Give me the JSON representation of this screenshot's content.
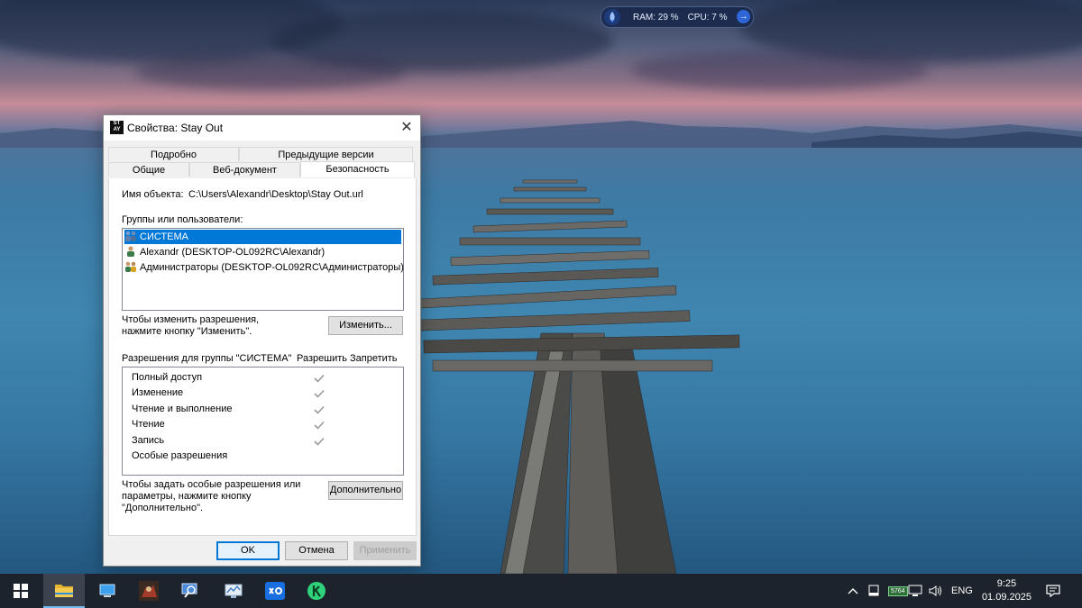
{
  "widget": {
    "ram": "RAM: 29 %",
    "cpu": "CPU: 7 %"
  },
  "dialog": {
    "title": "Свойства: Stay Out",
    "tabs_top": [
      "Подробно",
      "Предыдущие версии"
    ],
    "tabs_bottom": [
      "Общие",
      "Веб-документ",
      "Безопасность"
    ],
    "active_tab": "Безопасность",
    "object_label": "Имя объекта:",
    "object_value": "C:\\Users\\Alexandr\\Desktop\\Stay Out.url",
    "groups_label": "Группы или пользователи:",
    "groups": [
      "СИСТЕМА",
      "Alexandr (DESKTOP-OL092RC\\Alexandr)",
      "Администраторы (DESKTOP-OL092RC\\Администраторы)"
    ],
    "change_hint_1": "Чтобы изменить разрешения,",
    "change_hint_2": "нажмите кнопку \"Изменить\".",
    "change_button": "Изменить...",
    "perm_header": "Разрешения для группы \"СИСТЕМА\"",
    "allow_header": "Разрешить",
    "deny_header": "Запретить",
    "permissions": [
      {
        "name": "Полный доступ",
        "allow": true
      },
      {
        "name": "Изменение",
        "allow": true
      },
      {
        "name": "Чтение и выполнение",
        "allow": true
      },
      {
        "name": "Чтение",
        "allow": true
      },
      {
        "name": "Запись",
        "allow": true
      },
      {
        "name": "Особые разрешения",
        "allow": false
      }
    ],
    "advanced_hint_1": "Чтобы задать особые разрешения или",
    "advanced_hint_2": "параметры, нажмите кнопку",
    "advanced_hint_3": "\"Дополнительно\".",
    "advanced_button": "Дополнительно",
    "ok": "OK",
    "cancel": "Отмена",
    "apply": "Применить"
  },
  "taskbar": {
    "apps": [
      "start-icon",
      "file-explorer-icon",
      "this-pc-icon",
      "game-icon",
      "search-tool-icon",
      "network-tool-icon",
      "xbox-app-icon",
      "kaspersky-icon"
    ],
    "tray_badge": "5764",
    "language": "ENG",
    "time": "9:25",
    "date": "01.09.2025"
  }
}
